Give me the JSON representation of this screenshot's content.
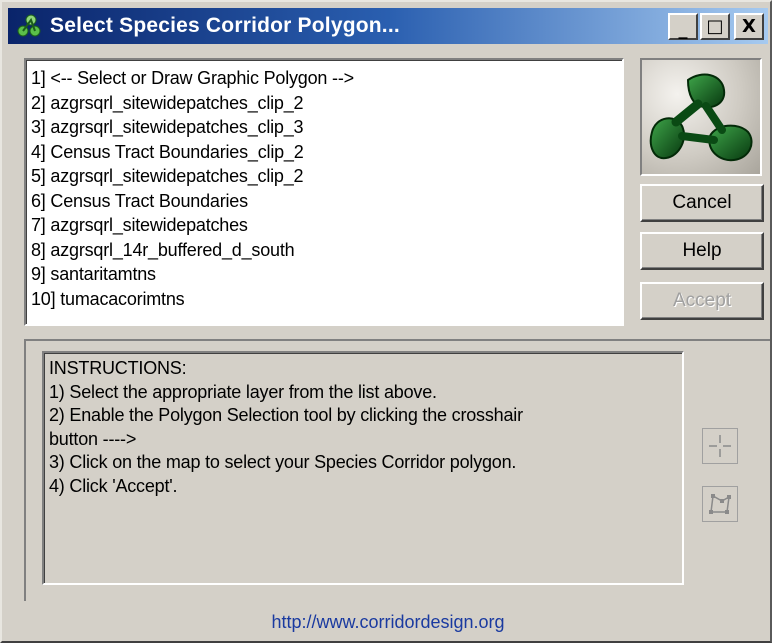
{
  "window": {
    "title": "Select Species Corridor Polygon...",
    "minimize_glyph": "_",
    "maximize_glyph": "□",
    "close_glyph": "X"
  },
  "layers": [
    "1] <-- Select or Draw Graphic Polygon -->",
    "2] azgrsqrl_sitewidepatches_clip_2",
    "3] azgrsqrl_sitewidepatches_clip_3",
    "4] Census Tract Boundaries_clip_2",
    "5] azgrsqrl_sitewidepatches_clip_2",
    "6] Census Tract Boundaries",
    "7] azgrsqrl_sitewidepatches",
    "8] azgrsqrl_14r_buffered_d_south",
    "9] santaritamtns",
    "10] tumacacorimtns"
  ],
  "buttons": {
    "cancel": "Cancel",
    "help": "Help",
    "accept": "Accept"
  },
  "instructions": [
    "INSTRUCTIONS:",
    "1) Select the appropriate layer from the list above.",
    "2) Enable the Polygon Selection tool by clicking the crosshair",
    "button ---->",
    "3) Click on the map to select your Species Corridor polygon.",
    "4) Click 'Accept'."
  ],
  "footer": {
    "link": "http://www.corridordesign.org"
  },
  "icons": {
    "title": "corridor-logo-icon",
    "logo": "corridor-logo-icon",
    "crosshair": "crosshair-icon",
    "polygon": "polygon-select-icon"
  },
  "colors": {
    "title_bar_start": "#0a246a",
    "title_bar_end": "#a6caf0",
    "logo_green": "#0f5a1c",
    "link": "#1a3aa0"
  },
  "state": {
    "accept_enabled": false
  }
}
